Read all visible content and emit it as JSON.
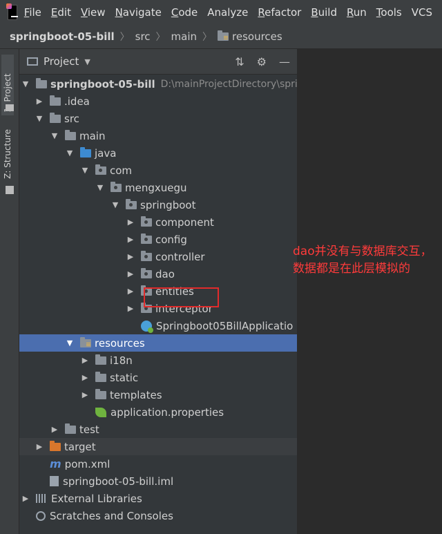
{
  "menubar": {
    "items": [
      {
        "label": "File",
        "u": "F",
        "rest": "ile"
      },
      {
        "label": "Edit",
        "u": "E",
        "rest": "dit"
      },
      {
        "label": "View",
        "u": "V",
        "rest": "iew"
      },
      {
        "label": "Navigate",
        "u": "N",
        "rest": "avigate"
      },
      {
        "label": "Code",
        "u": "C",
        "rest": "ode"
      },
      {
        "label": "Analyze",
        "u": "",
        "rest": "Analyze"
      },
      {
        "label": "Refactor",
        "u": "R",
        "rest": "efactor"
      },
      {
        "label": "Build",
        "u": "B",
        "rest": "uild"
      },
      {
        "label": "Run",
        "u": "R",
        "rest": "un"
      },
      {
        "label": "Tools",
        "u": "T",
        "rest": "ools"
      },
      {
        "label": "VCS",
        "u": "",
        "rest": "VCS"
      }
    ]
  },
  "breadcrumb": {
    "items": [
      "springboot-05-bill",
      "src",
      "main",
      "resources"
    ]
  },
  "side_tabs": {
    "project": "1: Project",
    "structure": "Z: Structure"
  },
  "panel": {
    "title": "Project"
  },
  "tree": {
    "root_label": "springboot-05-bill",
    "root_path": "D:\\mainProjectDirectory\\spri",
    "idea": ".idea",
    "src": "src",
    "main": "main",
    "java": "java",
    "com": "com",
    "mengxuegu": "mengxuegu",
    "springboot": "springboot",
    "component": "component",
    "config": "config",
    "controller": "controller",
    "dao": "dao",
    "entities": "entities",
    "interceptor": "interceptor",
    "app_class": "Springboot05BillApplicatio",
    "resources": "resources",
    "i18n": "i18n",
    "static": "static",
    "templates": "templates",
    "app_props": "application.properties",
    "test": "test",
    "target": "target",
    "pom": "pom.xml",
    "iml": "springboot-05-bill.iml",
    "ext_libs": "External Libraries",
    "scratches": "Scratches and Consoles"
  },
  "annotation": {
    "text": "dao并没有与数据库交互，数据都是在此层模拟的",
    "color": "#ff3b3b"
  },
  "colors": {
    "selection": "#4b6eaf",
    "folder_blue": "#3d8bd1",
    "folder_orange": "#d9772c"
  }
}
